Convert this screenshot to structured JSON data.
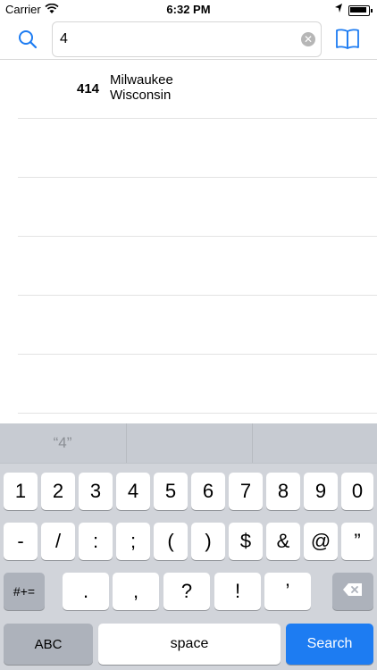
{
  "status_bar": {
    "carrier": "Carrier",
    "time": "6:32 PM"
  },
  "search": {
    "value": "4",
    "placeholder": ""
  },
  "results": [
    {
      "code": "414",
      "city": "Milwaukee",
      "state": "Wisconsin"
    },
    {
      "code": "",
      "city": "",
      "state": ""
    },
    {
      "code": "",
      "city": "",
      "state": ""
    },
    {
      "code": "",
      "city": "",
      "state": ""
    },
    {
      "code": "",
      "city": "",
      "state": ""
    },
    {
      "code": "",
      "city": "",
      "state": ""
    }
  ],
  "keyboard": {
    "suggestions": [
      "“4”",
      "",
      ""
    ],
    "row1": [
      "1",
      "2",
      "3",
      "4",
      "5",
      "6",
      "7",
      "8",
      "9",
      "0"
    ],
    "row2": [
      "-",
      "/",
      ":",
      ";",
      "(",
      ")",
      "$",
      "&",
      "@",
      "”"
    ],
    "row3": {
      "shift_label": "#+=",
      "keys": [
        ".",
        ",",
        "?",
        "!",
        "’"
      ]
    },
    "row4": {
      "abc_label": "ABC",
      "space_label": "space",
      "search_label": "Search"
    }
  },
  "colors": {
    "accent": "#1d7cf2",
    "keyboard_bg": "#d1d4da"
  }
}
